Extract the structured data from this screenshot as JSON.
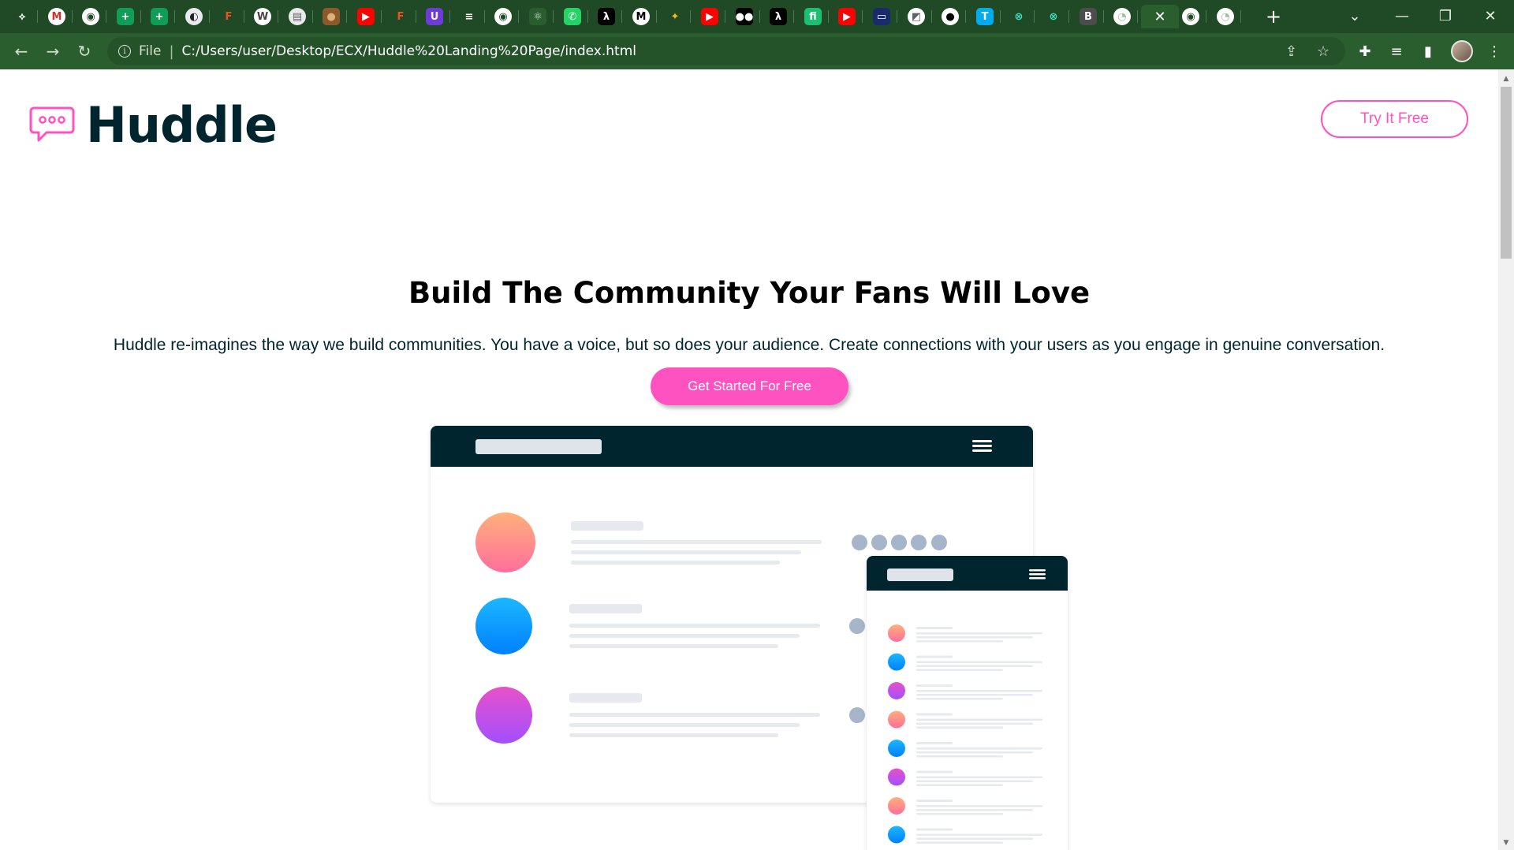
{
  "browser": {
    "tabs": [
      {
        "icon": "feedly-icon",
        "color": "#1f4a25",
        "glyph": "⟡"
      },
      {
        "icon": "gmail-icon",
        "color": "#ffffff",
        "glyph": "M",
        "fg": "#d93025"
      },
      {
        "icon": "globe-icon",
        "color": "#ffffff",
        "glyph": "◉",
        "fg": "#1f4a25"
      },
      {
        "icon": "sheets-icon",
        "color": "#0f9d58",
        "glyph": "+"
      },
      {
        "icon": "sheets-icon",
        "color": "#0f9d58",
        "glyph": "+"
      },
      {
        "icon": "profile-icon",
        "color": "#e8eaed",
        "glyph": "◐",
        "fg": "#202124"
      },
      {
        "icon": "figma-icon",
        "color": "#1f4a25",
        "glyph": "F",
        "fg": "#f24e1e"
      },
      {
        "icon": "wordpress-icon",
        "color": "#ffffff",
        "glyph": "W",
        "fg": "#464342"
      },
      {
        "icon": "docs-icon",
        "color": "#e8eaed",
        "glyph": "▤",
        "fg": "#5f6368"
      },
      {
        "icon": "avatar-icon",
        "color": "#8d5a2b",
        "glyph": "●",
        "fg": "#e0b07a"
      },
      {
        "icon": "youtube-icon",
        "color": "#ff0000",
        "glyph": "▶"
      },
      {
        "icon": "figma-icon",
        "color": "#1f4a25",
        "glyph": "F",
        "fg": "#f24e1e"
      },
      {
        "icon": "upwork-icon",
        "color": "#6e3bd6",
        "glyph": "U"
      },
      {
        "icon": "bars-icon",
        "color": "#1f4a25",
        "glyph": "≡",
        "fg": "#ffffff"
      },
      {
        "icon": "globe-icon",
        "color": "#ffffff",
        "glyph": "◉",
        "fg": "#1f4a25"
      },
      {
        "icon": "react-icon",
        "color": "#2b5e2f",
        "glyph": "⚛",
        "fg": "#cfe0cf"
      },
      {
        "icon": "whatsapp-icon",
        "color": "#25d366",
        "glyph": "✆"
      },
      {
        "icon": "lambda-icon",
        "color": "#000000",
        "glyph": "λ"
      },
      {
        "icon": "medium-icon",
        "color": "#ffffff",
        "glyph": "M",
        "fg": "#000000"
      },
      {
        "icon": "google-icon",
        "color": "#1f4a25",
        "glyph": "✦",
        "fg": "#fbbc05"
      },
      {
        "icon": "youtube-icon",
        "color": "#ff0000",
        "glyph": "▶"
      },
      {
        "icon": "medium-icon",
        "color": "#000000",
        "glyph": "●●"
      },
      {
        "icon": "lambda-icon",
        "color": "#000000",
        "glyph": "λ"
      },
      {
        "icon": "fiverr-icon",
        "color": "#1dbf73",
        "glyph": "fi"
      },
      {
        "icon": "youtube-icon",
        "color": "#ff0000",
        "glyph": "▶"
      },
      {
        "icon": "screen-icon",
        "color": "#1a2b6d",
        "glyph": "▭"
      },
      {
        "icon": "docs-icon",
        "color": "#ffffff",
        "glyph": "◩",
        "fg": "#5f6368"
      },
      {
        "icon": "github-icon",
        "color": "#ffffff",
        "glyph": "●",
        "fg": "#000000"
      },
      {
        "icon": "twitter-icon",
        "color": "#00acee",
        "glyph": "T"
      },
      {
        "icon": "frontendmentor-icon",
        "color": "#1f4a25",
        "glyph": "⊗",
        "fg": "#3fe0c5"
      },
      {
        "icon": "frontendmentor-icon",
        "color": "#1f4a25",
        "glyph": "⊗",
        "fg": "#3fe0c5"
      },
      {
        "icon": "bootstrap-icon",
        "color": "#4d4d4d",
        "glyph": "B"
      },
      {
        "icon": "circle-icon",
        "color": "#ffffff",
        "glyph": "◔",
        "fg": "#9fbf9f"
      },
      {
        "icon": "close-icon",
        "color": "#2b5e2f",
        "glyph": "✕",
        "active": true
      },
      {
        "icon": "globe-icon",
        "color": "#ffffff",
        "glyph": "◉",
        "fg": "#1f4a25"
      },
      {
        "icon": "circle-icon",
        "color": "#ffffff",
        "glyph": "◔",
        "fg": "#9fbf9f"
      }
    ],
    "omnibox_scheme": "File",
    "url": "C:/Users/user/Desktop/ECX/Huddle%20Landing%20Page/index.html"
  },
  "page": {
    "logo_text": "Huddle",
    "try_button": "Try It Free",
    "hero_title": "Build The Community Your Fans Will Love",
    "hero_description": "Huddle re-imagines the way we build communities. You have a voice, but so does your audience. Create connections with your users as you engage in genuine conversation.",
    "cta_button": "Get Started For Free"
  },
  "colors": {
    "brand_pink": "#ff52c1",
    "brand_dark": "#00252e",
    "chrome_green": "#2b5e2f",
    "chrome_dark_green": "#1f4a25"
  }
}
